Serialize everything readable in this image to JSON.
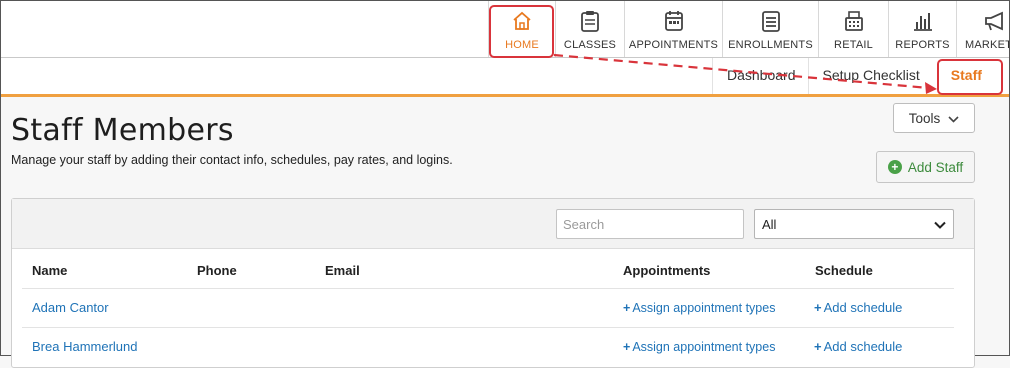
{
  "topnav": {
    "items": [
      {
        "label": "HOME",
        "icon": "home-icon",
        "active": true
      },
      {
        "label": "CLASSES",
        "icon": "clipboard-icon"
      },
      {
        "label": "APPOINTMENTS",
        "icon": "calendar-icon"
      },
      {
        "label": "ENROLLMENTS",
        "icon": "list-icon"
      },
      {
        "label": "RETAIL",
        "icon": "register-icon"
      },
      {
        "label": "REPORTS",
        "icon": "bar-chart-icon"
      },
      {
        "label": "MARKETI",
        "icon": "megaphone-icon"
      }
    ],
    "active_color": "#e8791f"
  },
  "subnav": {
    "items": [
      {
        "label": "Dashboard"
      },
      {
        "label": "Setup Checklist"
      },
      {
        "label": "Staff",
        "active": true
      }
    ]
  },
  "header": {
    "title": "Staff Members",
    "description": "Manage your staff by adding their contact info, schedules, pay rates, and logins.",
    "tools_label": "Tools",
    "add_staff_label": "Add Staff"
  },
  "filters": {
    "search_placeholder": "Search",
    "select_value": "All"
  },
  "table": {
    "columns": [
      "Name",
      "Phone",
      "Email",
      "Appointments",
      "Schedule"
    ],
    "rows": [
      {
        "name": "Adam Cantor",
        "appointments": "Assign appointment types",
        "schedule": "Add schedule"
      },
      {
        "name": "Brea Hammerlund",
        "appointments": "Assign appointment types",
        "schedule": "Add schedule"
      }
    ]
  },
  "colors": {
    "accent": "#e8791f",
    "annotation": "#d9343b",
    "link": "#1f73b7",
    "add_green": "#4aa148"
  }
}
